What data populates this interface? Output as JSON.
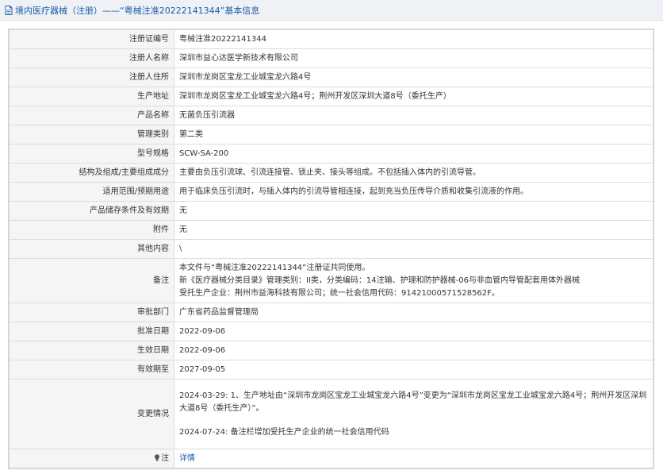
{
  "header": {
    "title": "境内医疗器械（注册）——“粤械注准20222141344”基本信息"
  },
  "rows": [
    {
      "label": "注册证编号",
      "value": "粤械注准20222141344"
    },
    {
      "label": "注册人名称",
      "value": "深圳市益心达医学新技术有限公司"
    },
    {
      "label": "注册人住所",
      "value": "深圳市龙岗区宝龙工业城宝龙六路4号"
    },
    {
      "label": "生产地址",
      "value": "深圳市龙岗区宝龙工业城宝龙六路4号；荆州开发区深圳大道8号（委托生产）"
    },
    {
      "label": "产品名称",
      "value": "无菌负压引流器"
    },
    {
      "label": "管理类别",
      "value": "第二类"
    },
    {
      "label": "型号规格",
      "value": "SCW-SA-200"
    },
    {
      "label": "结构及组成/主要组成成分",
      "value": "主要由负压引流球、引流连接管、锁止夹、接头等组成。不包括插入体内的引流导管。"
    },
    {
      "label": "适用范围/预期用途",
      "value": "用于临床负压引流时，与插入体内的引流导管相连接，起到充当负压传导介质和收集引流液的作用。"
    },
    {
      "label": "产品储存条件及有效期",
      "value": "无"
    },
    {
      "label": "附件",
      "value": "无"
    },
    {
      "label": "其他内容",
      "value": "\\"
    }
  ],
  "remark": {
    "label": "备注",
    "lines": [
      "本文件与“粤械注准20222141344”注册证共同使用。",
      "新《医疗器械分类目录》管理类别：II类，分类编码：14注输、护理和防护器械-06与非血管内导管配套用体外器械",
      "受托生产企业：荆州市益海科技有限公司；统一社会信用代码：91421000571528562F。"
    ]
  },
  "rows2": [
    {
      "label": "审批部门",
      "value": "广东省药品监督管理局"
    },
    {
      "label": "批准日期",
      "value": "2022-09-06"
    },
    {
      "label": "生效日期",
      "value": "2022-09-06"
    },
    {
      "label": "有效期至",
      "value": "2027-09-05"
    }
  ],
  "changes": {
    "label": "变更情况",
    "entry1": "2024-03-29: 1、生产地址由“深圳市龙岗区宝龙工业城宝龙六路4号”变更为“深圳市龙岗区宝龙工业城宝龙六路4号；荆州开发区深圳大道8号（委托生产）”。",
    "entry2": "2024-07-24: 备注栏增加受托生产企业的统一社会信用代码"
  },
  "note": {
    "label": "注",
    "icon": "lightbulb-icon",
    "link_text": "详情"
  }
}
